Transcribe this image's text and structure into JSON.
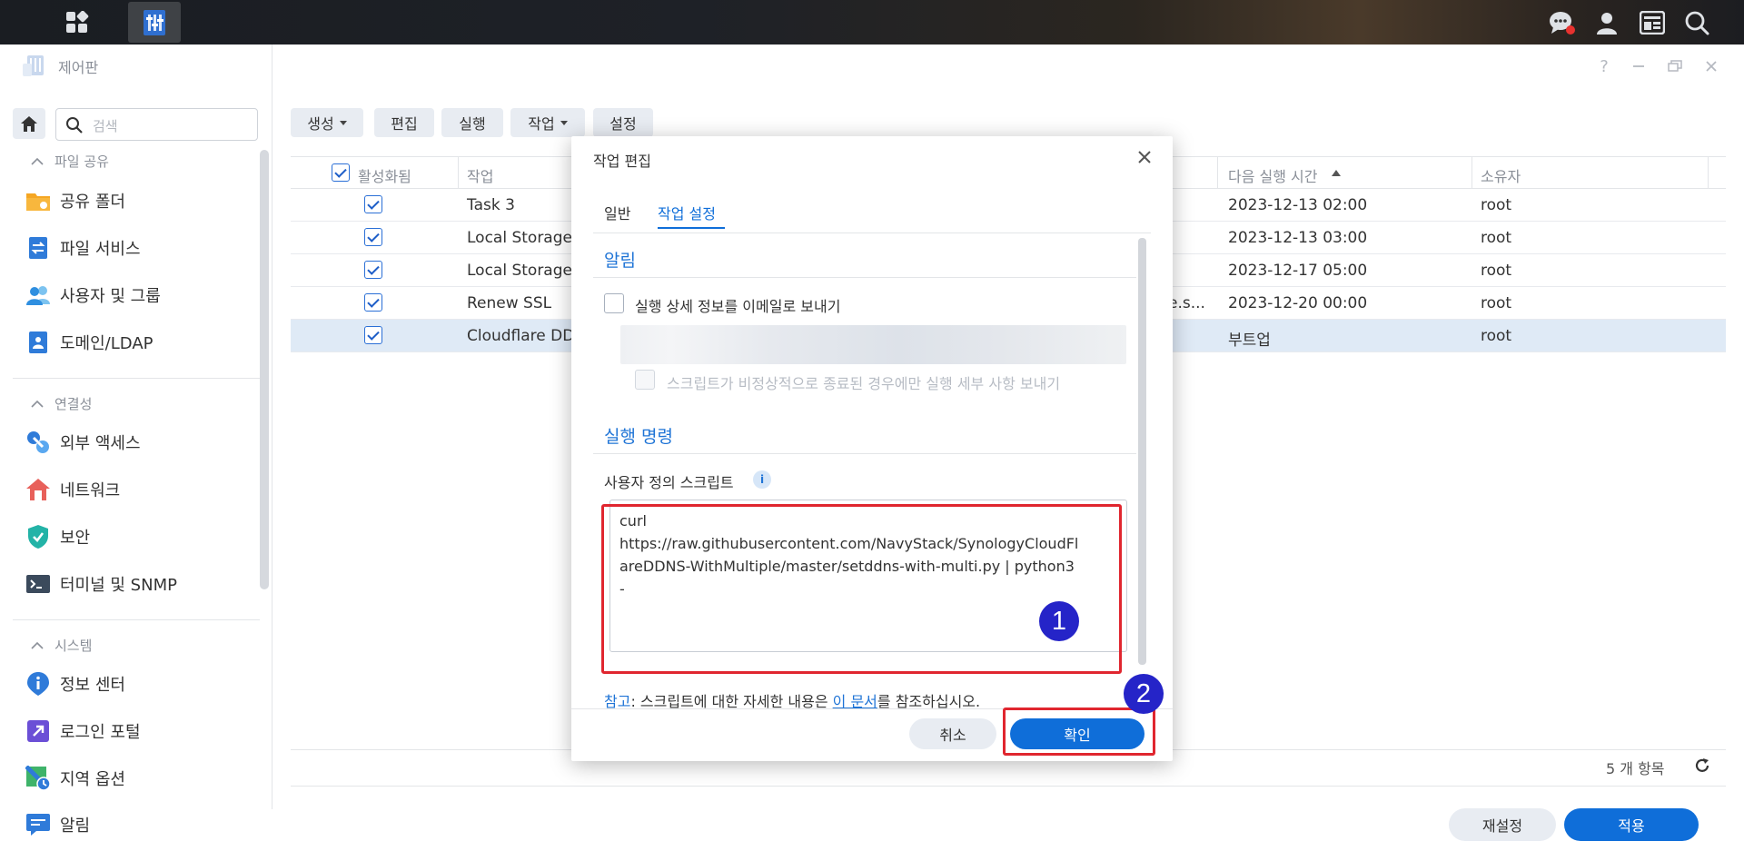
{
  "window": {
    "title": "제어판"
  },
  "sidebar": {
    "search_placeholder": "검색",
    "sections": [
      {
        "label": "파일 공유",
        "items": [
          "공유 폴더",
          "파일 서비스",
          "사용자 및 그룹",
          "도메인/LDAP"
        ]
      },
      {
        "label": "연결성",
        "items": [
          "외부 액세스",
          "네트워크",
          "보안",
          "터미널 및 SNMP"
        ]
      },
      {
        "label": "시스템",
        "items": [
          "정보 센터",
          "로그인 포털",
          "지역 옵션",
          "알림"
        ]
      }
    ]
  },
  "toolbar": {
    "create": "생성",
    "edit": "편집",
    "run": "실행",
    "action": "작업",
    "settings": "설정"
  },
  "table": {
    "headers": {
      "enabled": "활성화됨",
      "task": "작업",
      "next_run": "다음 실행 시간",
      "owner": "소유자"
    },
    "rows": [
      {
        "task": "Task 3",
        "extra": "",
        "next_run": "2023-12-13 02:00",
        "owner": "root"
      },
      {
        "task": "Local Storage",
        "extra": "",
        "next_run": "2023-12-13 03:00",
        "owner": "root"
      },
      {
        "task": "Local Storage",
        "extra": "",
        "next_run": "2023-12-17 05:00",
        "owner": "root"
      },
      {
        "task": "Renew SSL",
        "extra": "e.s...",
        "next_run": "2023-12-20 00:00",
        "owner": "root"
      },
      {
        "task": "Cloudflare DD",
        "extra": "",
        "next_run": "부트업",
        "owner": "root"
      }
    ],
    "count": "5 개 항목"
  },
  "footer": {
    "reset": "재설정",
    "apply": "적용"
  },
  "modal": {
    "title": "작업 편집",
    "tabs": [
      "일반",
      "작업 설정"
    ],
    "section_notify": "알림",
    "email_option": "실행 상세 정보를 이메일로 보내기",
    "abnormal_option": "스크립트가 비정상적으로 종료된 경우에만 실행 세부 사항 보내기",
    "section_command": "실행 명령",
    "script_label": "사용자 정의 스크립트",
    "script_lines": [
      "curl",
      "https://raw.githubusercontent.com/NavyStack/SynologyCloudFl",
      "areDDNS-WithMultiple/master/setddns-with-multi.py | python3",
      "-"
    ],
    "note_prefix": "참고",
    "note_mid": ": 스크립트에 대한 자세한 내용은 ",
    "note_link": "이 문서",
    "note_suffix": "를 참조하십시오.",
    "cancel": "취소",
    "ok": "확인"
  },
  "annotations": {
    "badge1": "1",
    "badge2": "2"
  },
  "colors": {
    "accent": "#0f6ed9",
    "highlight": "#e0262f",
    "badge": "#2524c8"
  }
}
